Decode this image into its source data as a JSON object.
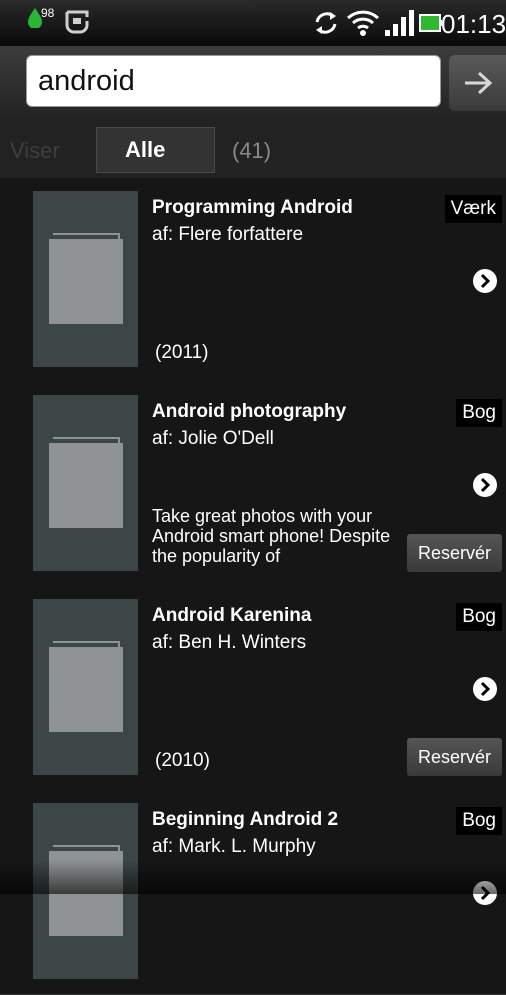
{
  "status_bar": {
    "notification_count": "98",
    "time": "01:13"
  },
  "search": {
    "query": "android",
    "go_icon": "arrow-right-icon"
  },
  "filter": {
    "label": "Viser",
    "active_tab": "Alle",
    "count": "(41)"
  },
  "results": [
    {
      "title": "Programming Android",
      "author": "af:  Flere forfattere",
      "type": "Værk",
      "year": "(2011)",
      "description": "",
      "reserve": ""
    },
    {
      "title": "Android photography",
      "author": "af:  Jolie O'Dell",
      "type": "Bog",
      "year": "",
      "description": "Take great photos with your Android smart phone! Despite the popularity of",
      "reserve": "Reservér"
    },
    {
      "title": "Android Karenina",
      "author": "af:  Ben H. Winters",
      "type": "Bog",
      "year": "(2010)",
      "description": "",
      "reserve": "Reservér"
    },
    {
      "title": "Beginning Android 2",
      "author": "af:  Mark. L. Murphy",
      "type": "Bog",
      "year": "",
      "description": "",
      "reserve": ""
    }
  ],
  "colors": {
    "background": "#151515",
    "thumbnail": "#3c4646",
    "badge": "#000000"
  }
}
